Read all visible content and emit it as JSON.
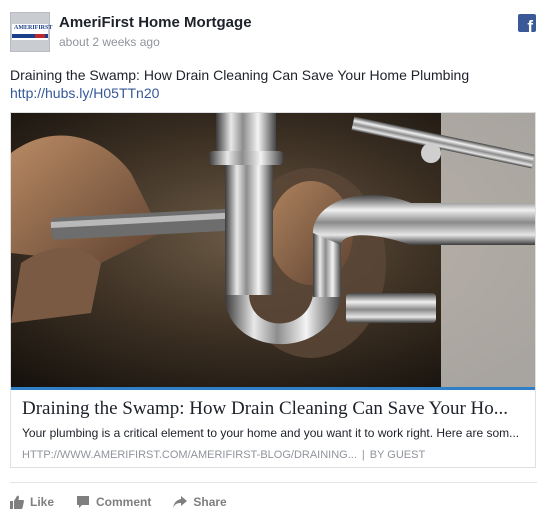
{
  "post": {
    "page_name": "AmeriFirst Home Mortgage",
    "timestamp": "about 2 weeks ago",
    "message": "Draining the Swamp: How Drain Cleaning Can Save Your Home Plumbing",
    "link_url": "http://hubs.ly/H05TTn20",
    "avatar_text": "AMERIFIRST",
    "fb_icon": "facebook-icon"
  },
  "attachment": {
    "image_icon": "photo",
    "title": "Draining the Swamp: How Drain Cleaning Can Save Your Ho...",
    "description": "Your plumbing is a critical element to your home and you want it to work right. Here are som...",
    "source_url": "HTTP://WWW.AMERIFIRST.COM/AMERIFIRST-BLOG/DRAINING...",
    "separator": "|",
    "author": "BY GUEST"
  },
  "actions": {
    "like_label": "Like",
    "comment_label": "Comment",
    "share_label": "Share"
  },
  "colors": {
    "facebook_blue": "#3b5998",
    "link_color": "#365899",
    "accent_bar": "#2f80c8",
    "muted_text": "#90949c"
  }
}
